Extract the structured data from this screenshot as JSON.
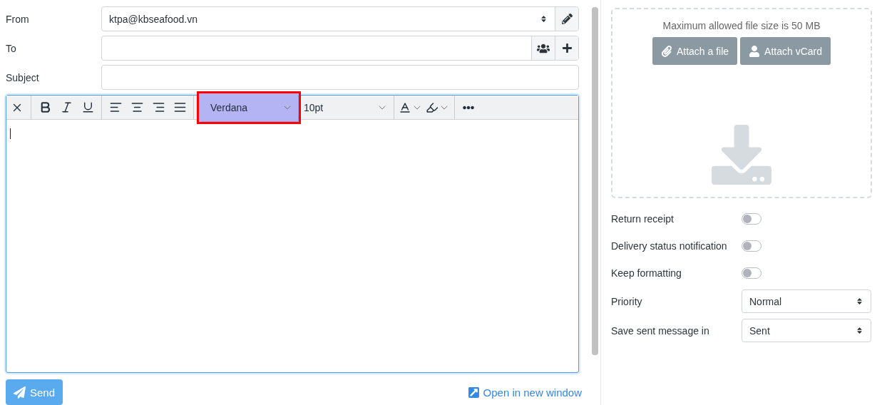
{
  "fields": [
    {
      "label": "From",
      "kind": "select",
      "value": "ktpa@kbseafood.vn",
      "actions": [
        {
          "kind": "edit"
        }
      ]
    },
    {
      "label": "To",
      "kind": "text",
      "actions": [
        {
          "kind": "contacts"
        },
        {
          "kind": "add"
        }
      ]
    },
    {
      "label": "Subject",
      "kind": "text"
    }
  ],
  "toolbar": [
    {
      "kind": "clear"
    },
    {
      "kind": "separator"
    },
    {
      "kind": "bold"
    },
    {
      "kind": "italic"
    },
    {
      "kind": "underline"
    },
    {
      "kind": "separator"
    },
    {
      "kind": "align-left"
    },
    {
      "kind": "align-center"
    },
    {
      "kind": "align-right"
    },
    {
      "kind": "justify"
    },
    {
      "kind": "separator"
    },
    {
      "kind": "font",
      "value": "Verdana",
      "highlighted": true
    },
    {
      "kind": "size",
      "value": "10pt",
      "highlighted": false
    },
    {
      "kind": "separator"
    },
    {
      "kind": "text-color"
    },
    {
      "kind": "highlight-color"
    },
    {
      "kind": "separator"
    },
    {
      "kind": "more"
    }
  ],
  "send_button": "Send",
  "open_new_window": "Open in new window",
  "attachments": {
    "hint": "Maximum allowed file size is 50 MB",
    "buttons": [
      {
        "label": "Attach a file",
        "kind": "file"
      },
      {
        "label": "Attach vCard",
        "kind": "vcard"
      }
    ]
  },
  "options": [
    {
      "label": "Return receipt",
      "kind": "toggle",
      "on": false
    },
    {
      "label": "Delivery status notification",
      "kind": "toggle",
      "on": false
    },
    {
      "label": "Keep formatting",
      "kind": "toggle",
      "on": false
    },
    {
      "label": "Priority",
      "kind": "select",
      "value": "Normal"
    },
    {
      "label": "Save sent message in",
      "kind": "select",
      "value": "Sent"
    }
  ]
}
